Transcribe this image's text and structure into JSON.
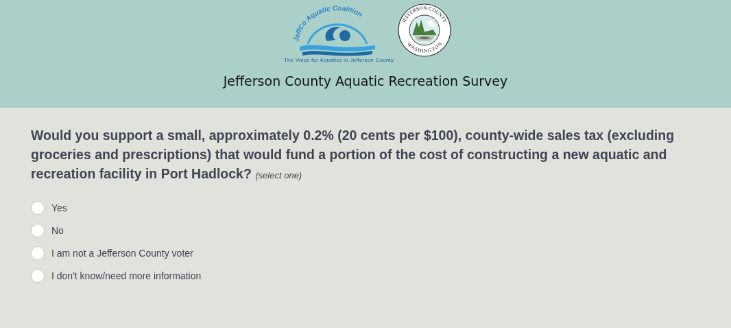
{
  "header": {
    "logos": [
      {
        "kind": "coalition",
        "arc_text": "JeffCo Aquatic Coalition",
        "tagline": "The Voice for Aquatics in Jefferson County"
      },
      {
        "kind": "seal",
        "top_text": "JEFFERSON COUNTY",
        "bottom_text": "WASHINGTON"
      }
    ],
    "title": "Jefferson County Aquatic Recreation Survey"
  },
  "question": {
    "text": "Would you support a small, approximately 0.2% (20 cents per $100), county-wide sales tax (excluding groceries and prescriptions) that would fund a portion of the cost of constructing a new aquatic and recreation facility in Port Hadlock?",
    "hint": "(select one)"
  },
  "options": [
    {
      "label": "Yes",
      "selected": false
    },
    {
      "label": "No",
      "selected": false
    },
    {
      "label": "I am not a Jefferson County voter",
      "selected": false
    },
    {
      "label": "I don't know/need more information",
      "selected": false
    }
  ]
}
